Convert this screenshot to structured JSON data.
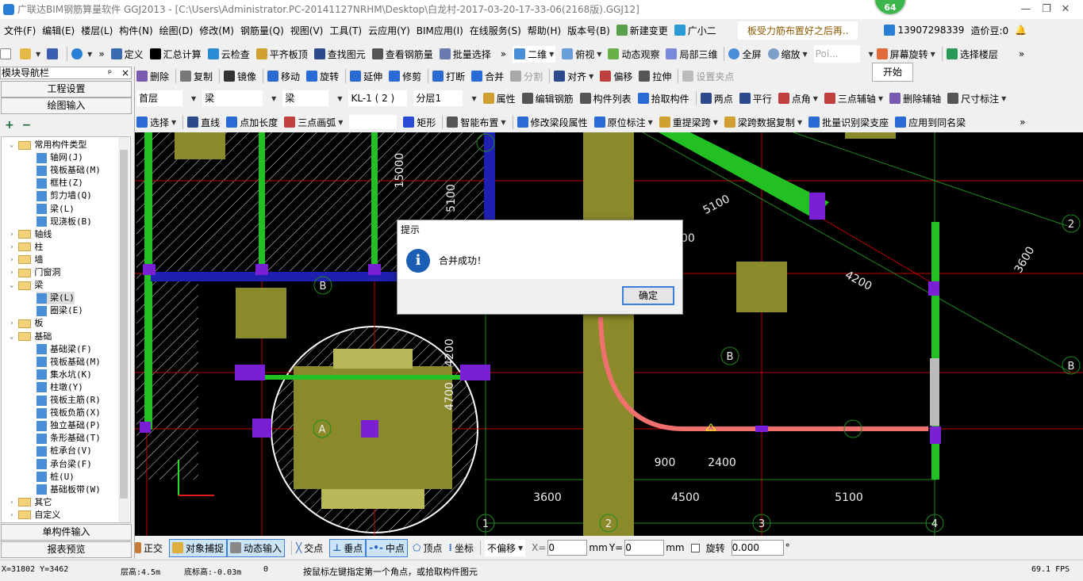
{
  "window": {
    "title": "广联达BIM钢筋算量软件 GGJ2013 - [C:\\Users\\Administrator.PC-20141127NRHM\\Desktop\\白龙村-2017-03-20-17-33-06(2168版).GGJ12]",
    "badge": "64",
    "min": "—",
    "restore": "❐",
    "close": "✕"
  },
  "menu": [
    "文件(F)",
    "编辑(E)",
    "楼层(L)",
    "构件(N)",
    "绘图(D)",
    "修改(M)",
    "钢筋量(Q)",
    "视图(V)",
    "工具(T)",
    "云应用(Y)",
    "BIM应用(I)",
    "在线服务(S)",
    "帮助(H)",
    "版本号(B)"
  ],
  "menu_right": {
    "new_change": "新建变更",
    "assistant": "广小二",
    "tip": "板受力筋布置好之后再..",
    "user": "13907298339",
    "beans": "造价豆:0"
  },
  "toolbar1": {
    "items": [
      "定义",
      "汇总计算",
      "云检查",
      "平齐板顶",
      "查找图元",
      "查看钢筋量",
      "批量选择"
    ],
    "view": [
      "二维",
      "俯视",
      "动态观察",
      "局部三维",
      "全屏",
      "缩放"
    ],
    "point_input": "Poi...",
    "rotate_screen": "屏幕旋转",
    "select_floor": "选择楼层",
    "popup_start": "开始"
  },
  "toolbar2": [
    "删除",
    "复制",
    "镜像",
    "移动",
    "旋转",
    "延伸",
    "修剪",
    "打断",
    "合并",
    "分割",
    "对齐",
    "偏移",
    "拉伸",
    "设置夹点"
  ],
  "toolbar3": {
    "floor": "首层",
    "cat": "梁",
    "type": "梁",
    "member": "KL-1 ( 2 )",
    "layer": "分层1",
    "items": [
      "属性",
      "编辑钢筋",
      "构件列表",
      "拾取构件",
      "两点",
      "平行",
      "点角",
      "三点辅轴",
      "删除辅轴",
      "尺寸标注"
    ]
  },
  "toolbar4": [
    "选择",
    "直线",
    "点加长度",
    "三点画弧",
    "矩形",
    "智能布置",
    "修改梁段属性",
    "原位标注",
    "重提梁跨",
    "梁跨数据复制",
    "批量识别梁支座",
    "应用到同名梁"
  ],
  "sidebar": {
    "title": "模块导航栏",
    "pin": "ᵖ",
    "close": "×",
    "project_settings": "工程设置",
    "drawing_input": "绘图输入",
    "single_input": "单构件输入",
    "report_preview": "报表预览",
    "tree": [
      {
        "label": "常用构件类型",
        "level": 0,
        "folder": true,
        "open": true
      },
      {
        "label": "轴网(J)",
        "level": 1
      },
      {
        "label": "筏板基础(M)",
        "level": 1
      },
      {
        "label": "框柱(Z)",
        "level": 1
      },
      {
        "label": "剪力墙(Q)",
        "level": 1
      },
      {
        "label": "梁(L)",
        "level": 1
      },
      {
        "label": "现浇板(B)",
        "level": 1
      },
      {
        "label": "轴线",
        "level": 0,
        "folder": true
      },
      {
        "label": "柱",
        "level": 0,
        "folder": true
      },
      {
        "label": "墙",
        "level": 0,
        "folder": true
      },
      {
        "label": "门窗洞",
        "level": 0,
        "folder": true
      },
      {
        "label": "梁",
        "level": 0,
        "folder": true,
        "open": true
      },
      {
        "label": "梁(L)",
        "level": 1,
        "selected": true
      },
      {
        "label": "圈梁(E)",
        "level": 1
      },
      {
        "label": "板",
        "level": 0,
        "folder": true
      },
      {
        "label": "基础",
        "level": 0,
        "folder": true,
        "open": true
      },
      {
        "label": "基础梁(F)",
        "level": 1
      },
      {
        "label": "筏板基础(M)",
        "level": 1
      },
      {
        "label": "集水坑(K)",
        "level": 1
      },
      {
        "label": "柱墩(Y)",
        "level": 1
      },
      {
        "label": "筏板主筋(R)",
        "level": 1
      },
      {
        "label": "筏板负筋(X)",
        "level": 1
      },
      {
        "label": "独立基础(P)",
        "level": 1
      },
      {
        "label": "条形基础(T)",
        "level": 1
      },
      {
        "label": "桩承台(V)",
        "level": 1
      },
      {
        "label": "承台梁(F)",
        "level": 1
      },
      {
        "label": "桩(U)",
        "level": 1
      },
      {
        "label": "基础板带(W)",
        "level": 1
      },
      {
        "label": "其它",
        "level": 0,
        "folder": true
      },
      {
        "label": "自定义",
        "level": 0,
        "folder": true
      }
    ]
  },
  "canvas": {
    "dims": [
      "5100",
      "5100",
      "15000",
      "5100",
      "4200",
      "3600",
      "4200",
      "4700",
      "900",
      "2400",
      "3600",
      "4500",
      "5100"
    ],
    "axes": [
      "B",
      "B",
      "A",
      "1",
      "2",
      "3",
      "4",
      "2",
      "B"
    ]
  },
  "dialog": {
    "title": "提示",
    "message": "合并成功！",
    "ok": "确定"
  },
  "bottom": {
    "ortho": "正交",
    "snap": "对象捕捉",
    "dyn": "动态输入",
    "intersect": "交点",
    "perp": "垂点",
    "mid": "中点",
    "vertex": "顶点",
    "coord": "坐标",
    "offset": "不偏移",
    "x_label": "X=",
    "x": "0",
    "mm1": "mm",
    "y_label": "Y=",
    "y": "0",
    "mm2": "mm",
    "rotate": "旋转",
    "angle": "0.000",
    "deg": "°"
  },
  "status": {
    "coords": "X=31802 Y=3462",
    "floor_height": "层高:4.5m",
    "base_height": "底标高:-0.03m",
    "zero": "0",
    "hint": "按鼠标左键指定第一个角点，或拾取构件图元",
    "fps": "69.1 FPS"
  },
  "colors": {
    "beam": "#22b522",
    "column": "#7b1fd6",
    "footing": "#8a8a2a",
    "grid": "#c00000",
    "axis": "#2a9a2a"
  }
}
